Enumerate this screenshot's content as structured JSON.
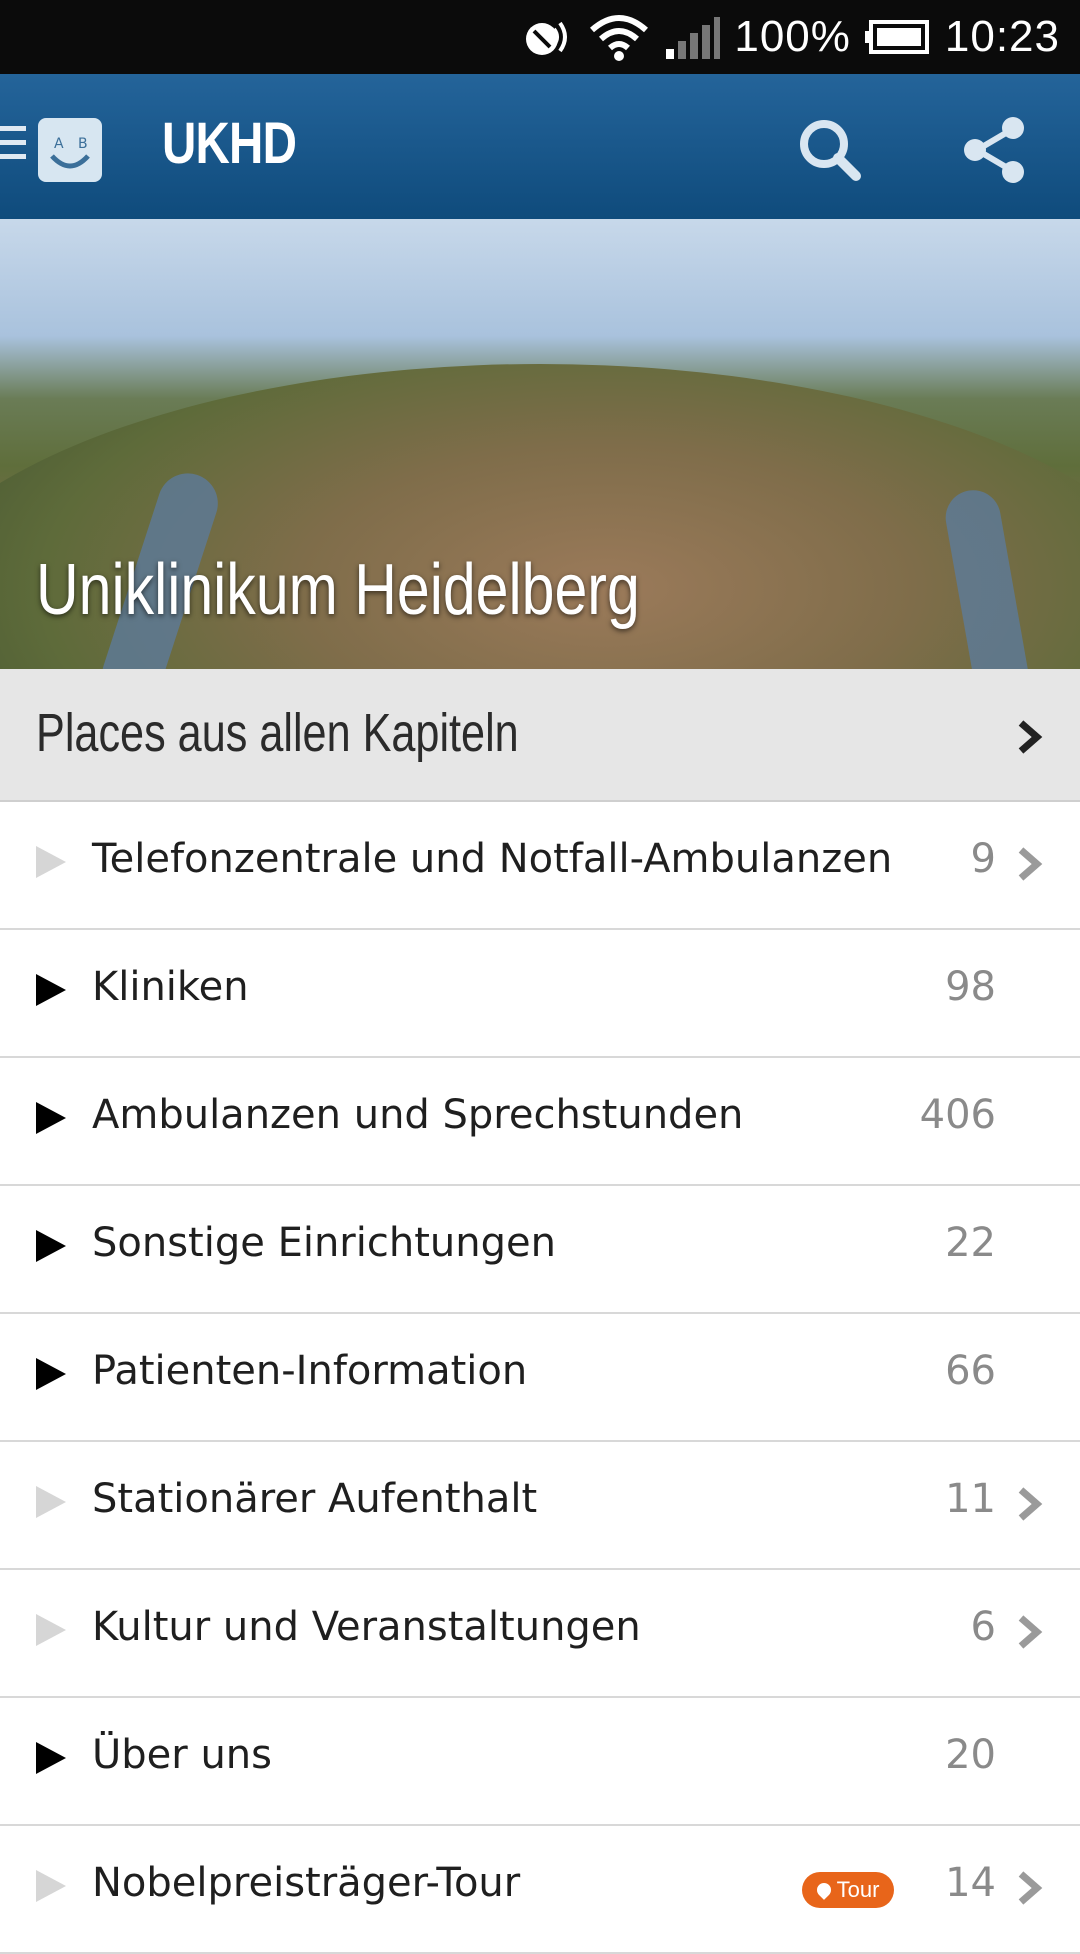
{
  "status_bar": {
    "battery": "100%",
    "time": "10:23",
    "icons": [
      "nfc-icon",
      "wifi-icon",
      "signal-icon",
      "battery-icon"
    ]
  },
  "app_bar": {
    "title": "UKHD",
    "logo": "ab-smiley-logo",
    "actions": [
      "search-icon",
      "share-icon"
    ],
    "color": "#174f80"
  },
  "hero": {
    "title": "Uniklinikum Heidelberg"
  },
  "section": {
    "title": "Places aus allen Kapiteln"
  },
  "list": [
    {
      "label": "Telefonzentrale und Notfall-Ambulanzen",
      "count": "9",
      "expandable": false,
      "chevron": true
    },
    {
      "label": "Kliniken",
      "count": "98",
      "expandable": true,
      "chevron": false
    },
    {
      "label": "Ambulanzen und Sprechstunden",
      "count": "406",
      "expandable": true,
      "chevron": false
    },
    {
      "label": "Sonstige Einrichtungen",
      "count": "22",
      "expandable": true,
      "chevron": false
    },
    {
      "label": "Patienten-Information",
      "count": "66",
      "expandable": true,
      "chevron": false
    },
    {
      "label": "Stationärer Aufenthalt",
      "count": "11",
      "expandable": false,
      "chevron": true
    },
    {
      "label": "Kultur und Veranstaltungen",
      "count": "6",
      "expandable": false,
      "chevron": true
    },
    {
      "label": "Über uns",
      "count": "20",
      "expandable": true,
      "chevron": false
    },
    {
      "label": "Nobelpreisträger-Tour",
      "count": "14",
      "expandable": false,
      "chevron": true,
      "badge": "Tour"
    }
  ],
  "colors": {
    "badge": "#e8651a",
    "section_bg": "#e6e6e6"
  }
}
